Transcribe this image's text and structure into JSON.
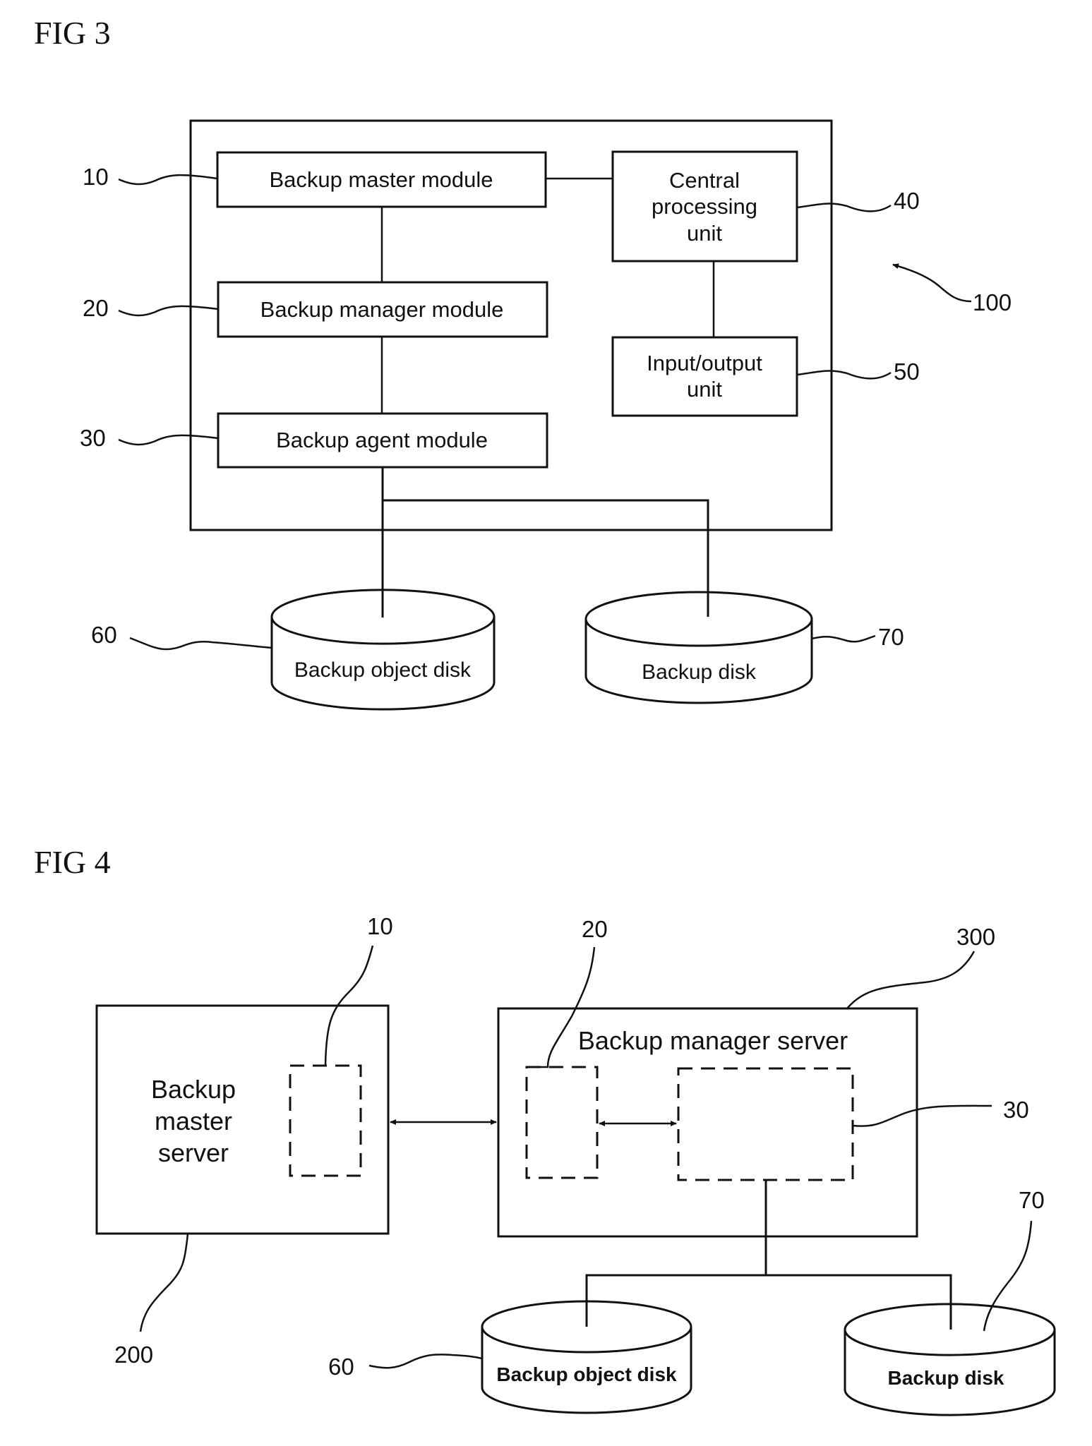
{
  "fig3": {
    "title": "FIG 3",
    "system_ref": "100",
    "modules": [
      {
        "ref": "10",
        "label": "Backup master module"
      },
      {
        "ref": "20",
        "label": "Backup manager module"
      },
      {
        "ref": "30",
        "label": "Backup agent module"
      }
    ],
    "cpu": {
      "ref": "40",
      "lines": [
        "Central",
        "processing",
        "unit"
      ]
    },
    "io": {
      "ref": "50",
      "lines": [
        "Input/output",
        "unit"
      ]
    },
    "disks": [
      {
        "ref": "60",
        "label": "Backup object disk"
      },
      {
        "ref": "70",
        "label": "Backup disk"
      }
    ]
  },
  "fig4": {
    "title": "FIG 4",
    "master_server": {
      "ref": "200",
      "lines": [
        "Backup",
        "master",
        "server"
      ],
      "module_ref": "10"
    },
    "manager_server": {
      "ref": "300",
      "label": "Backup manager server",
      "manager_module_ref": "20",
      "agent_module_ref": "30"
    },
    "disks": [
      {
        "ref": "60",
        "label": "Backup object disk"
      },
      {
        "ref": "70",
        "label": "Backup disk"
      }
    ]
  }
}
